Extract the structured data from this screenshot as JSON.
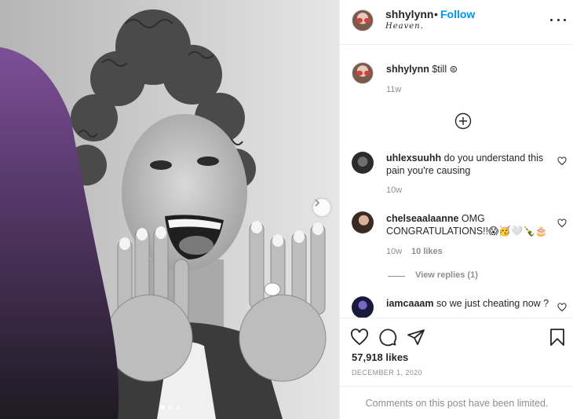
{
  "header": {
    "username": "shhylynn",
    "separator": "•",
    "follow_label": "Follow",
    "location": "Heaven."
  },
  "caption": {
    "username": "shhylynn",
    "text": "$till ⊜",
    "age": "11w"
  },
  "comments": [
    {
      "username": "uhlexsuuhh",
      "text": "do you understand this pain you're causing",
      "age": "10w",
      "likes": ""
    },
    {
      "username": "chelseaalaanne",
      "text": "OMG CONGRATULATIONS!!😱🥳🤍🍾🎂",
      "age": "10w",
      "likes": "10 likes"
    },
    {
      "username": "iamcaaam",
      "text": "so we just cheating now ?",
      "age": "",
      "likes": ""
    }
  ],
  "view_replies": "View replies (1)",
  "likes_count": "57,918 likes",
  "post_date": "DECEMBER 1, 2020",
  "comments_limited": "Comments on this post have been limited.",
  "carousel": {
    "total": 3,
    "active": 1
  },
  "icons": {
    "more": "more-options-icon",
    "load_more": "plus-circle-icon",
    "next": "chevron-right-icon",
    "like": "heart-icon",
    "comment": "comment-bubble-icon",
    "share": "paper-plane-icon",
    "save": "bookmark-icon"
  },
  "colors": {
    "accent": "#0095f6",
    "muted": "#8e8e8e",
    "text": "#262626",
    "border": "#efefef"
  }
}
